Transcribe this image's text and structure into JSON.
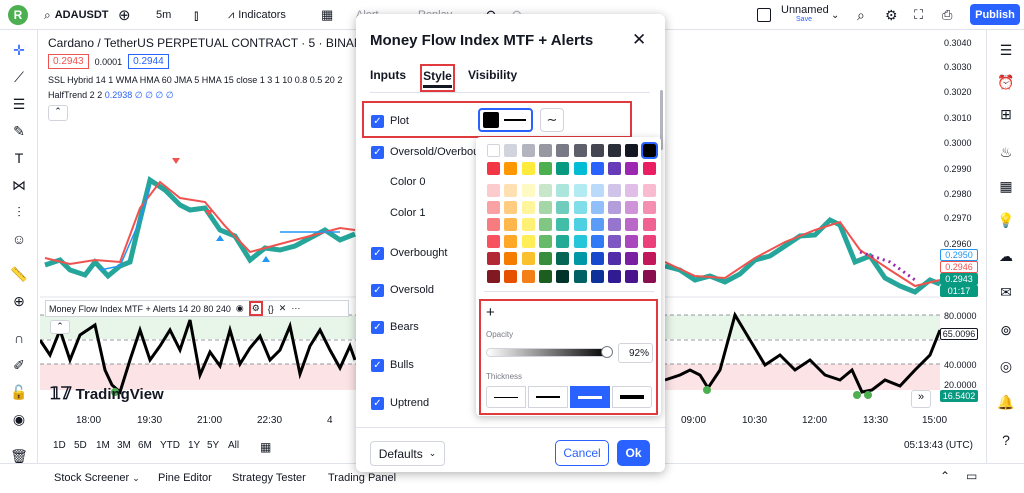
{
  "topbar": {
    "avatar": "R",
    "symbol": "ADAUSDT",
    "interval": "5m",
    "indicators": "Indicators",
    "alert": "Alert",
    "replay": "Replay",
    "layout_name": "Unnamed",
    "layout_status": "Save",
    "publish": "Publish"
  },
  "legend": {
    "title": "Cardano / TetherUS PERPETUAL CONTRACT · 5 · BINANCE",
    "bid": "0.2943",
    "spread": "0.0001",
    "ask": "0.2944",
    "ind1": "SSL Hybrid 14 1 WMA HMA 60 JMA 5 HMA 15 close 1 3 1 10 0.8 0.5 20 2",
    "ind2_name": "HalfTrend 2 2",
    "ind2_vals": "0.2938  ∅  ∅  ∅  ∅"
  },
  "pane2": {
    "title": "Money Flow Index MTF + Alerts 14 20 80 240"
  },
  "watermark": "TradingView",
  "price_axis": [
    "0.3040",
    "0.3030",
    "0.3020",
    "0.3010",
    "0.3000",
    "0.2990",
    "0.2980",
    "0.2970",
    "0.2960"
  ],
  "price_tags": {
    "blue": "0.2950",
    "red": "0.2946",
    "green": "0.2943",
    "countdown": "01:17"
  },
  "mfi_axis": {
    "top": "80.0000",
    "mid": "40.0000",
    "low": "20.0000",
    "current": "65.0096",
    "bottom": "16.5402"
  },
  "time_axis": [
    "18:00",
    "19:30",
    "21:00",
    "22:30",
    "4",
    "09:00",
    "10:30",
    "12:00",
    "13:30",
    "15:00"
  ],
  "periods": [
    "1D",
    "5D",
    "1M",
    "3M",
    "6M",
    "YTD",
    "1Y",
    "5Y",
    "All"
  ],
  "clock": "05:13:43 (UTC)",
  "bottom_tabs": [
    "Stock Screener",
    "Pine Editor",
    "Strategy Tester",
    "Trading Panel"
  ],
  "dialog": {
    "title": "Money Flow Index MTF + Alerts",
    "tabs": [
      "Inputs",
      "Style",
      "Visibility"
    ],
    "rows": [
      "Plot",
      "Oversold/Overbought",
      "Color 0",
      "Color 1",
      "Overbought",
      "Oversold",
      "Bears",
      "Bulls",
      "Uptrend"
    ],
    "defaults": "Defaults",
    "cancel": "Cancel",
    "ok": "Ok"
  },
  "palette": {
    "opacity_label": "Opacity",
    "opacity_value": "92%",
    "thickness_label": "Thickness",
    "add": "+",
    "grays": [
      "#ffffff",
      "#d1d4dc",
      "#b2b5be",
      "#9598a1",
      "#787b86",
      "#5d606b",
      "#434651",
      "#2a2e39",
      "#131722",
      "#000000"
    ],
    "main": [
      "#f23645",
      "#ff9800",
      "#ffeb3b",
      "#4caf50",
      "#089981",
      "#00bcd4",
      "#2962ff",
      "#673ab7",
      "#9c27b0",
      "#e91e63"
    ],
    "shades": [
      [
        "#fccbcd",
        "#ffe0b2",
        "#fff9c4",
        "#c8e6c9",
        "#ace5dc",
        "#b2ebf2",
        "#bbd9fb",
        "#d1c4e9",
        "#e1bee7",
        "#f8bbd0"
      ],
      [
        "#faa1a4",
        "#ffcc80",
        "#fff59d",
        "#a5d6a7",
        "#70ccbd",
        "#80deea",
        "#90bff9",
        "#b39ddb",
        "#ce93d8",
        "#f48fb1"
      ],
      [
        "#f77c80",
        "#ffb74d",
        "#fff176",
        "#81c784",
        "#42bda8",
        "#4dd0e1",
        "#5b9cf6",
        "#9575cd",
        "#ba68c8",
        "#f06292"
      ],
      [
        "#f7525f",
        "#ffa726",
        "#ffee58",
        "#66bb6a",
        "#22ab94",
        "#26c6da",
        "#3179f5",
        "#7e57c2",
        "#ab47bc",
        "#ec407a"
      ],
      [
        "#b22833",
        "#f57c00",
        "#fbc02d",
        "#388e3c",
        "#056656",
        "#0097a7",
        "#1848cc",
        "#512da8",
        "#7b1fa2",
        "#c2185b"
      ],
      [
        "#801922",
        "#e65100",
        "#f57f17",
        "#1b5e20",
        "#00332a",
        "#006064",
        "#0c3299",
        "#311b92",
        "#4a148c",
        "#880e4f"
      ]
    ]
  },
  "chart_data": {
    "type": "line",
    "series": [
      {
        "values": [
          0.2962,
          0.2968,
          0.2975,
          0.2985,
          0.2992,
          0.2988,
          0.298,
          0.2975,
          0.297,
          0.2968,
          0.2965,
          0.2963,
          0.2966,
          0.2972,
          0.2975,
          0.297,
          0.2962,
          0.2958,
          0.296,
          0.2966,
          0.2972,
          0.2968,
          0.2955,
          0.2948,
          0.2945,
          0.295,
          0.2946,
          0.2943
        ]
      }
    ]
  }
}
